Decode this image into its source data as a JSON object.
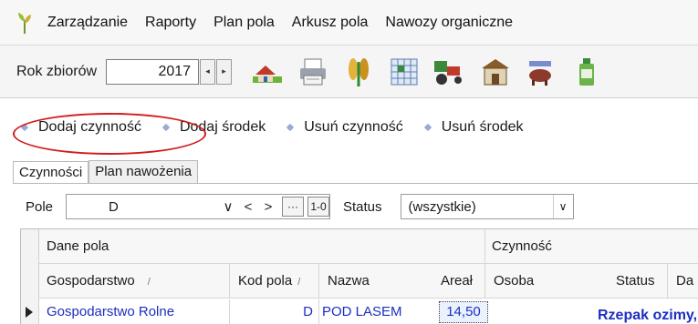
{
  "menu": {
    "logo_icon": "wheat-sprout-icon",
    "items": [
      "Zarządzanie",
      "Raporty",
      "Plan pola",
      "Arkusz pola",
      "Nawozy organiczne"
    ]
  },
  "toolbar": {
    "year_label": "Rok zbiorów",
    "year_value": "2017",
    "spin_left": "◂",
    "spin_right": "▸",
    "icons": [
      "farm-house-icon",
      "printer-icon",
      "grain-ears-icon",
      "field-grid-icon",
      "tractor-icon",
      "barn-icon",
      "livestock-icon",
      "bottle-icon"
    ]
  },
  "actions": {
    "add_activity": "Dodaj czynność",
    "add_agent": "Dodaj środek",
    "delete_activity": "Usuń czynność",
    "delete_agent": "Usuń środek"
  },
  "tabs": {
    "activities": "Czynności",
    "fertilization_plan": "Plan nawożenia"
  },
  "filter": {
    "field_label": "Pole",
    "field_value": "D",
    "chevron": "∨",
    "prev": "<",
    "next": ">",
    "more": "···",
    "toggle": "1-0",
    "status_label": "Status",
    "status_value": "(wszystkie)",
    "status_drop": "∨"
  },
  "grid": {
    "group_field_data": "Dane pola",
    "group_activity": "Czynność",
    "columns": {
      "farm": "Gospodarstwo",
      "field_code": "Kod pola",
      "name": "Nazwa",
      "area": "Areał",
      "person": "Osoba",
      "status": "Status",
      "date": "Da"
    },
    "sort_glyph": "/",
    "row": {
      "farm": "Gospodarstwo Rolne",
      "field_code": "D",
      "name": "POD LASEM",
      "area": "14,50",
      "activity_crop": "Rzepak ozimy,"
    }
  },
  "colors": {
    "highlight": "#d21b1b",
    "link": "#1c2fbf"
  }
}
